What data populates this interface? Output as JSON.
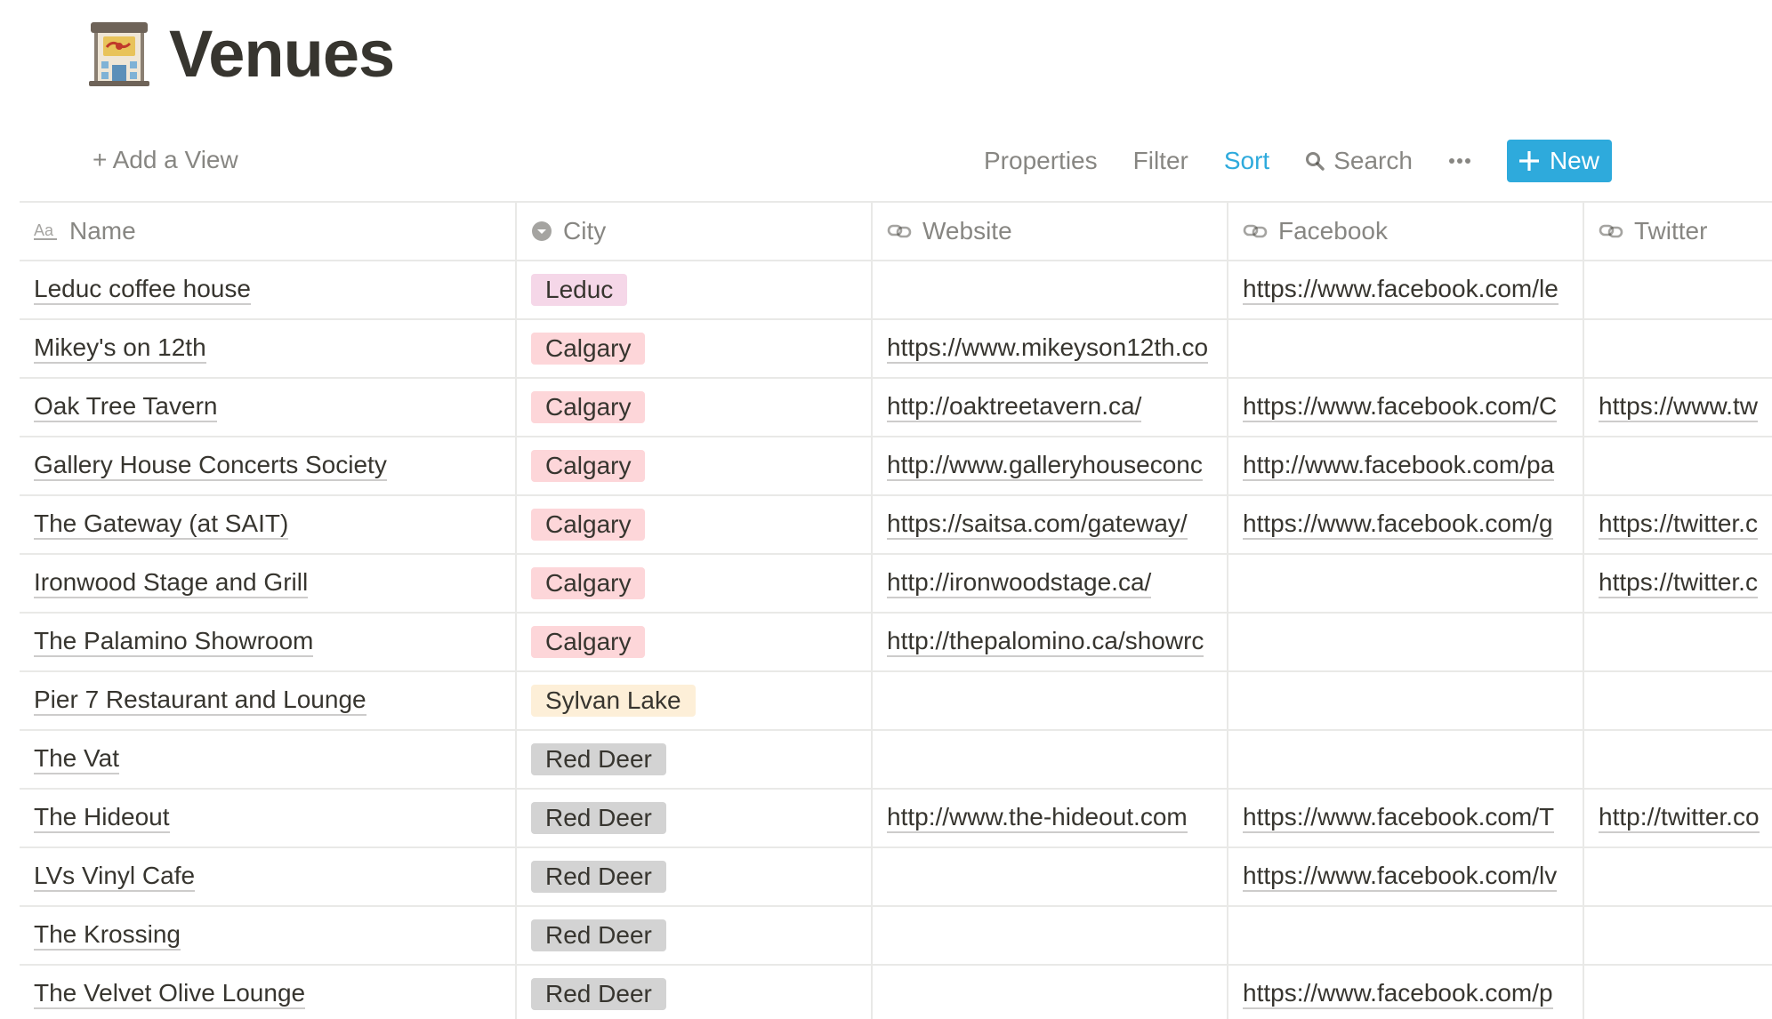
{
  "page": {
    "title": "Venues",
    "icon": "post-office-icon"
  },
  "toolbar": {
    "add_view": "+ Add a View",
    "properties": "Properties",
    "filter": "Filter",
    "sort": "Sort",
    "search": "Search",
    "more": "•••",
    "new": "New"
  },
  "colors": {
    "accent": "#2eaadc",
    "tag_leduc": "#f5d7e8",
    "tag_calgary": "#fdd6d9",
    "tag_sylvan": "#fdefd8",
    "tag_reddeer": "#d3d3d3"
  },
  "table": {
    "columns": [
      {
        "label": "Name",
        "icon": "text-type-icon"
      },
      {
        "label": "City",
        "icon": "select-icon"
      },
      {
        "label": "Website",
        "icon": "link-icon"
      },
      {
        "label": "Facebook",
        "icon": "link-icon"
      },
      {
        "label": "Twitter",
        "icon": "link-icon"
      }
    ],
    "rows": [
      {
        "name": "Leduc coffee house",
        "city": "Leduc",
        "tag": "leduc",
        "website": "",
        "facebook": "https://www.facebook.com/le",
        "twitter": ""
      },
      {
        "name": "Mikey's on 12th",
        "city": "Calgary",
        "tag": "calgary",
        "website": "https://www.mikeyson12th.co",
        "facebook": "",
        "twitter": ""
      },
      {
        "name": "Oak Tree Tavern",
        "city": "Calgary",
        "tag": "calgary",
        "website": "http://oaktreetavern.ca/",
        "facebook": "https://www.facebook.com/C",
        "twitter": "https://www.tw"
      },
      {
        "name": "Gallery House Concerts Society",
        "city": "Calgary",
        "tag": "calgary",
        "website": "http://www.galleryhouseconc",
        "facebook": "http://www.facebook.com/pa",
        "twitter": ""
      },
      {
        "name": "The Gateway (at SAIT)",
        "city": "Calgary",
        "tag": "calgary",
        "website": "https://saitsa.com/gateway/",
        "facebook": "https://www.facebook.com/g",
        "twitter": "https://twitter.c"
      },
      {
        "name": "Ironwood Stage and Grill",
        "city": "Calgary",
        "tag": "calgary",
        "website": "http://ironwoodstage.ca/",
        "facebook": "",
        "twitter": "https://twitter.c"
      },
      {
        "name": "The Palamino Showroom",
        "city": "Calgary",
        "tag": "calgary",
        "website": "http://thepalomino.ca/showrc",
        "facebook": "",
        "twitter": ""
      },
      {
        "name": "Pier 7 Restaurant and Lounge",
        "city": "Sylvan Lake",
        "tag": "sylvan",
        "website": "",
        "facebook": "",
        "twitter": ""
      },
      {
        "name": "The Vat",
        "city": "Red Deer",
        "tag": "reddeer",
        "website": "",
        "facebook": "",
        "twitter": ""
      },
      {
        "name": "The Hideout",
        "city": "Red Deer",
        "tag": "reddeer",
        "website": "http://www.the-hideout.com",
        "facebook": "https://www.facebook.com/T",
        "twitter": "http://twitter.co"
      },
      {
        "name": "LVs Vinyl Cafe",
        "city": "Red Deer",
        "tag": "reddeer",
        "website": "",
        "facebook": "https://www.facebook.com/lv",
        "twitter": ""
      },
      {
        "name": "The Krossing",
        "city": "Red Deer",
        "tag": "reddeer",
        "website": "",
        "facebook": "",
        "twitter": ""
      },
      {
        "name": "The Velvet Olive Lounge",
        "city": "Red Deer",
        "tag": "reddeer",
        "website": "",
        "facebook": "https://www.facebook.com/p",
        "twitter": ""
      }
    ]
  }
}
